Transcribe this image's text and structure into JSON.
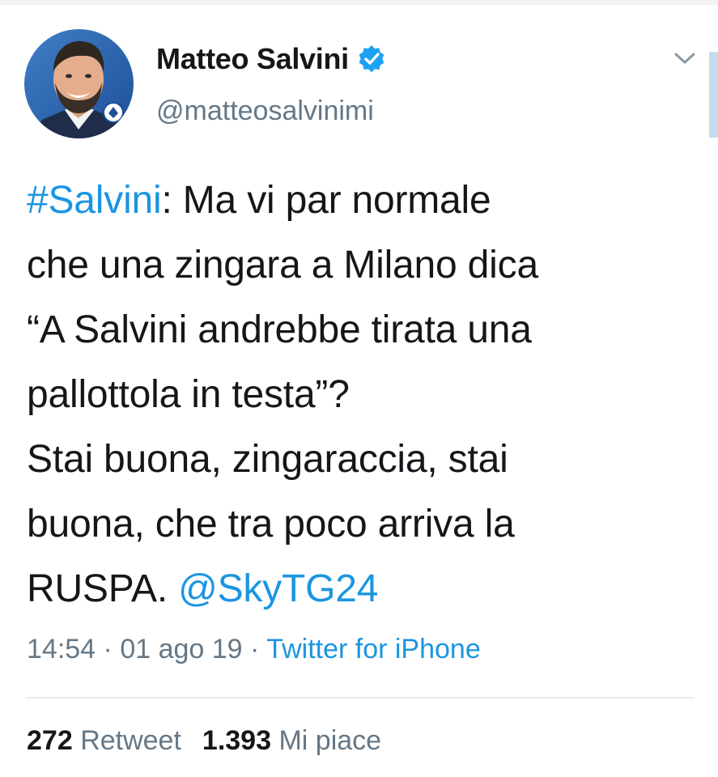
{
  "user": {
    "display_name": "Matteo Salvini",
    "handle": "@matteosalvinimi",
    "verified": true,
    "avatar_icon": "profile-photo"
  },
  "tweet": {
    "lines": [
      [
        {
          "text": "#Salvini",
          "link": true
        },
        {
          "text": ": Ma vi par normale",
          "link": false
        }
      ],
      [
        {
          "text": "che una zingara a Milano dica",
          "link": false
        }
      ],
      [
        {
          "text": "“A Salvini andrebbe tirata una",
          "link": false
        }
      ],
      [
        {
          "text": "pallottola in testa”?",
          "link": false
        }
      ],
      [
        {
          "text": "Stai buona, zingaraccia, stai",
          "link": false
        }
      ],
      [
        {
          "text": "buona, che tra poco arriva la",
          "link": false
        }
      ],
      [
        {
          "text": "RUSPA. ",
          "link": false
        },
        {
          "text": "@SkyTG24",
          "link": true
        }
      ]
    ]
  },
  "meta": {
    "time": "14:54",
    "separator": " · ",
    "date": "01 ago 19",
    "source": "Twitter for iPhone"
  },
  "stats": {
    "retweets_count": "272",
    "retweets_label": "Retweet",
    "likes_count": "1.393",
    "likes_label": "Mi piace"
  },
  "colors": {
    "link": "#1b95e0",
    "secondary_text": "#657786",
    "primary_text": "#14171a",
    "verified_badge": "#1da1f2"
  }
}
